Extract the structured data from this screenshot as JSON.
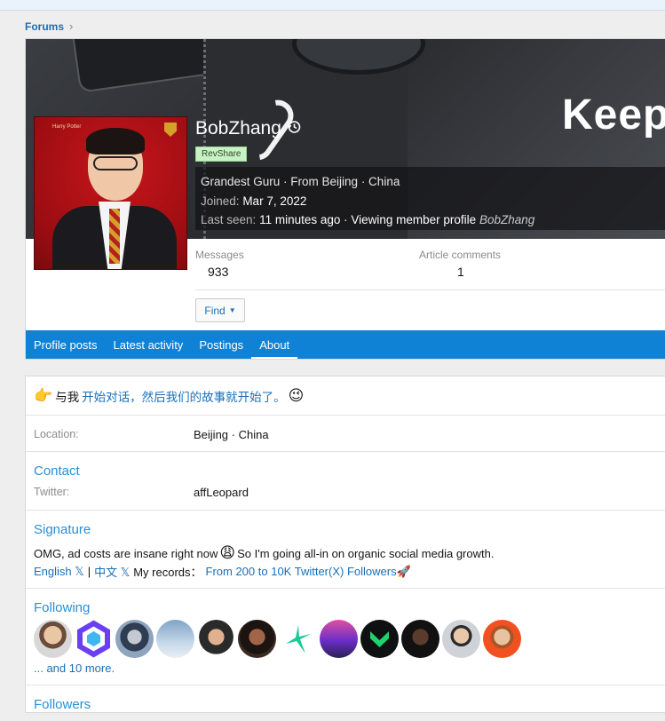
{
  "breadcrumb": {
    "forums": "Forums",
    "chevron": "›"
  },
  "cover": {
    "text": "Keep"
  },
  "profile": {
    "username": "BobZhang",
    "badge": "RevShare",
    "title_line": "Grandest Guru · From Beijing · China",
    "joined_label": "Joined:",
    "joined_value": "Mar 7, 2022",
    "lastseen_label": "Last seen:",
    "lastseen_value": "11 minutes ago · Viewing member profile",
    "lastseen_member": "BobZhang",
    "avatar_tag": "Harry Potter"
  },
  "stats": {
    "messages_label": "Messages",
    "messages_value": "933",
    "comments_label": "Article comments",
    "comments_value": "1"
  },
  "find_button": {
    "label": "Find",
    "caret": "▼"
  },
  "tabs": [
    {
      "label": "Profile posts"
    },
    {
      "label": "Latest activity"
    },
    {
      "label": "Postings"
    },
    {
      "label": "About"
    }
  ],
  "about": {
    "intro_emoji": "👉",
    "intro_prefix": "与我",
    "intro_link": "开始对话，然后我们的故事就开始了。",
    "intro_emoji_end": "😉",
    "location_label": "Location:",
    "location_value": "Beijing · China",
    "contact_title": "Contact",
    "twitter_label": "Twitter:",
    "twitter_value": "affLeopard",
    "signature_title": "Signature",
    "signature_line1_a": "OMG, ad costs are insane right now",
    "signature_emoji": "😩",
    "signature_line1_b": "So I'm going all-in on organic social media growth.",
    "sig_english": "English 𝕏",
    "sig_sep": "|",
    "sig_chinese": "中文 𝕏",
    "sig_records": "My records：",
    "sig_records_link": "From 200 to 10K Twitter(X) Followers🚀",
    "following_title": "Following",
    "following_more": "... and 10 more.",
    "followers_title": "Followers"
  },
  "colors": {
    "accent": "#0f82d6",
    "link": "#1a6fb5",
    "section": "#2a8fd4",
    "badge_bg": "#c7f2c4"
  }
}
